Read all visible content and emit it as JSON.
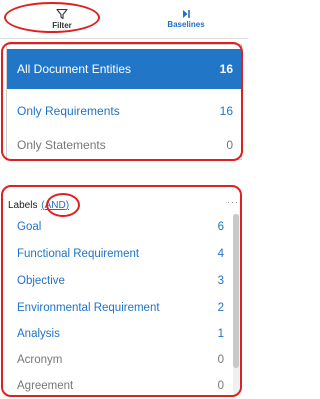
{
  "tabs": [
    {
      "label": "Filter",
      "icon": "filter-icon"
    },
    {
      "label": "Baselines",
      "icon": "baselines-icon"
    }
  ],
  "entity_filters": [
    {
      "label": "All Document Entities",
      "count": "16",
      "state": "selected"
    },
    {
      "label": "Only Requirements",
      "count": "16"
    },
    {
      "label": "Only Statements",
      "count": "0"
    }
  ],
  "labels": {
    "title": "Labels",
    "logic_open": "(",
    "logic_value": "AND",
    "logic_close": ")",
    "items": [
      {
        "label": "Goal",
        "count": "6"
      },
      {
        "label": "Functional Requirement",
        "count": "4"
      },
      {
        "label": "Objective",
        "count": "3"
      },
      {
        "label": "Environmental Requirement",
        "count": "2"
      },
      {
        "label": "Analysis",
        "count": "1"
      },
      {
        "label": "Acronym",
        "count": "0"
      },
      {
        "label": "Agreement",
        "count": "0"
      }
    ]
  },
  "colors": {
    "accent": "#2176c7",
    "link": "#1f73c8",
    "muted": "#777777",
    "annotation": "#e02020"
  }
}
